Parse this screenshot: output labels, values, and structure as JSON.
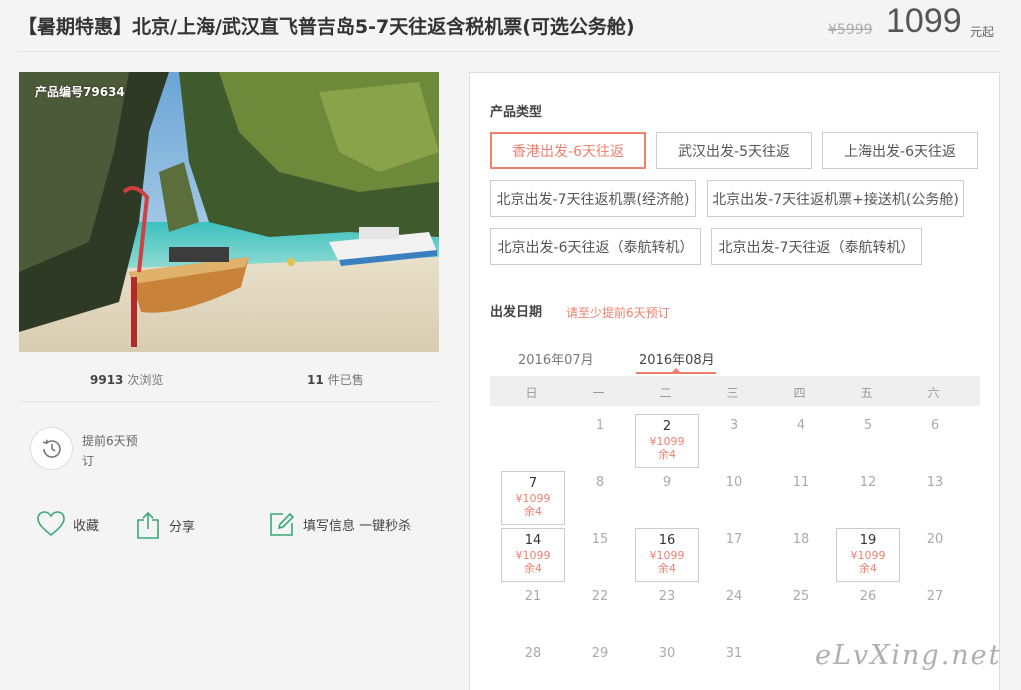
{
  "header": {
    "title": "【暑期特惠】北京/上海/武汉直飞普吉岛5-7天往返含税机票(可选公务舱)",
    "old_price": "¥5999",
    "price": "1099",
    "price_suffix": "元起"
  },
  "gallery": {
    "product_code": "产品编号79634"
  },
  "stats": {
    "views": "9913",
    "views_label": "次浏览",
    "sold": "11",
    "sold_label": "件已售"
  },
  "advance": {
    "text": "提前6天预订"
  },
  "actions": {
    "favorite": "收藏",
    "share": "分享",
    "fill": "填写信息 一键秒杀"
  },
  "product_types": {
    "label": "产品类型",
    "options": [
      "香港出发-6天往返",
      "武汉出发-5天往返",
      "上海出发-6天往返",
      "北京出发-7天往返机票(经济舱)",
      "北京出发-7天往返机票+接送机(公务舱)",
      "北京出发-6天往返（泰航转机）",
      "北京出发-7天往返（泰航转机）"
    ],
    "selected": 0
  },
  "departure": {
    "label": "出发日期",
    "hint": "请至少提前6天预订",
    "months": [
      "2016年07月",
      "2016年08月"
    ],
    "weekdays": [
      "日",
      "一",
      "二",
      "三",
      "四",
      "五",
      "六"
    ],
    "days": [
      {
        "d": "1"
      },
      {
        "d": "2",
        "price": "¥1099",
        "stock": "余4"
      },
      {
        "d": "3"
      },
      {
        "d": "4"
      },
      {
        "d": "5"
      },
      {
        "d": "6"
      },
      {
        "d": "7",
        "price": "¥1099",
        "stock": "余4"
      },
      {
        "d": "8"
      },
      {
        "d": "9"
      },
      {
        "d": "10"
      },
      {
        "d": "11"
      },
      {
        "d": "12"
      },
      {
        "d": "13"
      },
      {
        "d": "14",
        "price": "¥1099",
        "stock": "余4"
      },
      {
        "d": "15"
      },
      {
        "d": "16",
        "price": "¥1099",
        "stock": "余4"
      },
      {
        "d": "17"
      },
      {
        "d": "18"
      },
      {
        "d": "19",
        "price": "¥1099",
        "stock": "余4"
      },
      {
        "d": "20"
      },
      {
        "d": "21"
      },
      {
        "d": "22"
      },
      {
        "d": "23"
      },
      {
        "d": "24"
      },
      {
        "d": "25"
      },
      {
        "d": "26"
      },
      {
        "d": "27"
      },
      {
        "d": "28"
      },
      {
        "d": "29"
      },
      {
        "d": "30"
      },
      {
        "d": "31"
      }
    ]
  },
  "watermark": "eLvXing.net",
  "colors": {
    "accent": "#f07f6e",
    "icon_green": "#3aa875"
  }
}
